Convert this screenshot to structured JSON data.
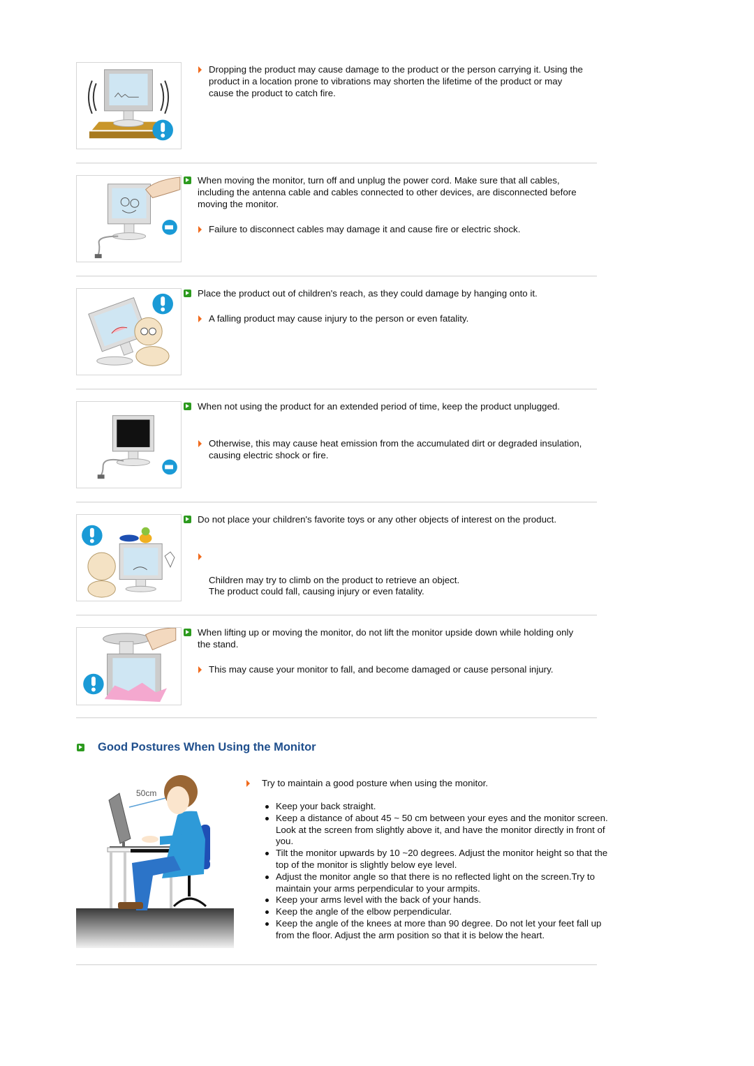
{
  "sections": [
    {
      "image": "monitor-shaking-on-table-warning",
      "main": "",
      "subs": [
        "Dropping the product may cause damage to the product or the person carrying it. Using the product in a location prone to vibrations may shorten the lifetime of the product or may cause the product to catch fire."
      ]
    },
    {
      "image": "monitor-unplug-cable",
      "main": "When moving the monitor, turn off and unplug the power cord. Make sure that all cables, including the antenna cable and cables connected to other devices, are disconnected before moving the monitor.",
      "subs": [
        "Failure to disconnect cables may damage it and cause fire or electric shock."
      ]
    },
    {
      "image": "child-hanging-on-monitor-warning",
      "main": "Place the product out of children's reach, as they could damage by hanging onto it.",
      "subs": [
        "A falling product may cause injury to the person or even fatality."
      ]
    },
    {
      "image": "monitor-unplugged",
      "main": "When not using the product for an extended period of time, keep the product unplugged.",
      "subs": [
        "Otherwise, this may cause heat emission from the accumulated dirt or degraded insulation, causing electric shock or fire."
      ]
    },
    {
      "image": "toys-on-monitor-warning",
      "main": "Do not place your children's favorite toys or any other objects of interest on the product.",
      "subs": [
        "Children may try to climb on the product to retrieve an object.\nThe product could fall, causing injury or even fatality."
      ]
    },
    {
      "image": "monitor-upside-down-by-stand-warning",
      "main": "When lifting up or moving the monitor, do not lift the monitor upside down while holding only the stand.",
      "subs": [
        "This may cause your monitor to fall, and become damaged or cause personal injury."
      ]
    }
  ],
  "posture": {
    "heading": "Good Postures When Using the Monitor",
    "image_label": "50cm",
    "intro": "Try to maintain a good posture when using the monitor.",
    "bullets": [
      "Keep your back straight.",
      "Keep a distance of about 45 ~ 50 cm between your eyes and the monitor screen. Look at the screen from slightly above it, and have the monitor directly in front of you.",
      "Tilt the monitor upwards by 10 ~20 degrees. Adjust the monitor height so that the top of the monitor is slightly below eye level.",
      "Adjust the monitor angle so that there is no reflected light on the screen.Try to maintain your arms perpendicular to your armpits.",
      "Keep your arms level with the back of your hands.",
      "Keep the angle of the elbow perpendicular.",
      "Keep the angle of the knees at more than 90 degree. Do not let your feet fall up from the floor. Adjust the arm position so that it is below the heart."
    ]
  },
  "colors": {
    "heading": "#1f4f8d",
    "green_icon": "#2c9a1e",
    "orange_arrow": "#f06a1c",
    "warning_blue": "#1a9ad6"
  }
}
